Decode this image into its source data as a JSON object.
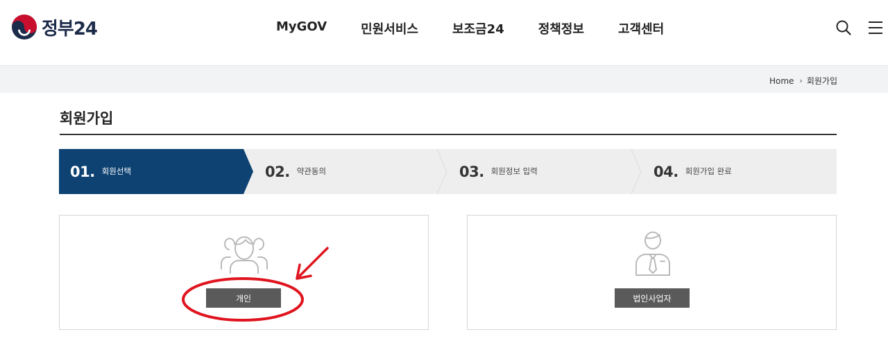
{
  "header": {
    "logo_text": "정부24",
    "nav": [
      "MyGOV",
      "민원서비스",
      "보조금24",
      "정책정보",
      "고객센터"
    ],
    "search_icon": "search-icon",
    "menu_icon": "hamburger-menu-icon"
  },
  "breadcrumb": {
    "home": "Home",
    "separator": "›",
    "current": "회원가입"
  },
  "page": {
    "title": "회원가입"
  },
  "steps": [
    {
      "num": "01.",
      "label": "회원선택",
      "active": true
    },
    {
      "num": "02.",
      "label": "약관동의",
      "active": false
    },
    {
      "num": "03.",
      "label": "회원정보 입력",
      "active": false
    },
    {
      "num": "04.",
      "label": "회원가입 완료",
      "active": false
    }
  ],
  "cards": {
    "personal": {
      "icon": "people-group-icon",
      "button": "개인"
    },
    "corporate": {
      "icon": "businessman-icon",
      "button": "법인사업자"
    }
  },
  "colors": {
    "active_step": "#0d4272",
    "step_bg": "#eeeeee",
    "button": "#5a5a5a",
    "annotation": "#e0141e",
    "logo_red": "#c8102e",
    "logo_blue": "#1d2b4a"
  }
}
